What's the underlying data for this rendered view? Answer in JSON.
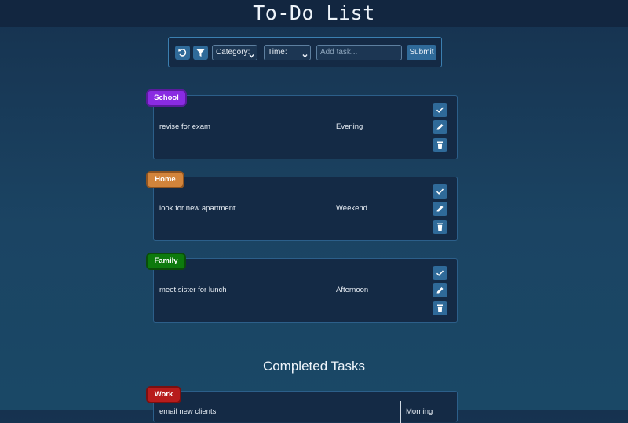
{
  "page_title": "To-Do List",
  "toolbar": {
    "undo_icon": "undo-icon",
    "filter_icon": "filter-icon",
    "category_select": "Category:",
    "time_select": "Time:",
    "task_input_placeholder": "Add task...",
    "submit_label": "Submit"
  },
  "tasks": [
    {
      "category": "School",
      "category_color": "#8a2be2",
      "text": "revise for exam",
      "time": "Evening"
    },
    {
      "category": "Home",
      "category_color": "#d2843b",
      "text": "look for new apartment",
      "time": "Weekend"
    },
    {
      "category": "Family",
      "category_color": "#0d7a0d",
      "text": "meet sister for lunch",
      "time": "Afternoon"
    }
  ],
  "task_actions": [
    "check-icon",
    "edit-icon",
    "trash-icon"
  ],
  "completed_section": {
    "title": "Completed Tasks",
    "tasks": [
      {
        "category": "Work",
        "category_color": "#b71c1c",
        "text": "email new clients",
        "time": "Morning"
      }
    ]
  },
  "colors": {
    "background": "#1b4463",
    "card": "#142a45",
    "button": "#2f6a99",
    "border": "#2c5f8a"
  }
}
